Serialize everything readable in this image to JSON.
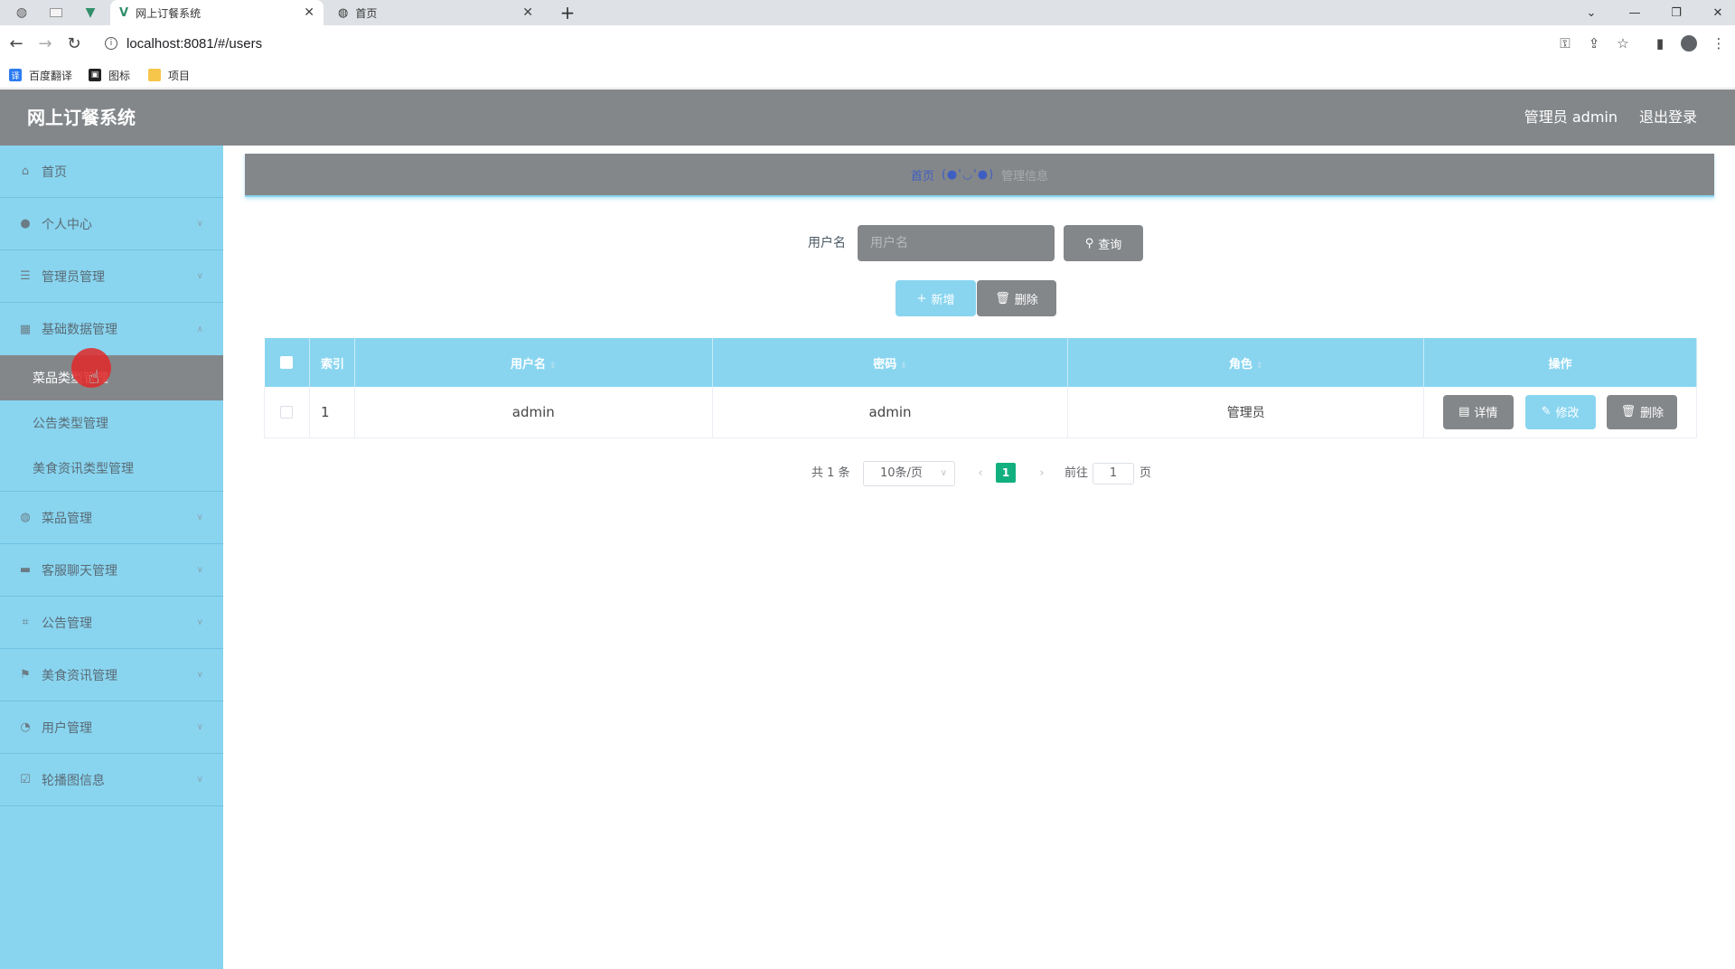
{
  "browser": {
    "tabs": [
      {
        "title": "网上订餐系统",
        "favicon": "vue-logo-icon",
        "active": true
      },
      {
        "title": "首页",
        "favicon": "globe-icon",
        "active": false
      }
    ],
    "url": "localhost:8081/#/users",
    "bookmarks": [
      {
        "label": "百度翻译",
        "icon": "baidu-translate-icon",
        "color": "#2d7cf2"
      },
      {
        "label": "图标",
        "icon": "iconfont-icon",
        "color": "#222222"
      },
      {
        "label": "项目",
        "icon": "folder-icon",
        "color": "#f6c64b"
      }
    ]
  },
  "header": {
    "title": "网上订餐系统",
    "user": "管理员 admin",
    "logout": "退出登录"
  },
  "sidebar": {
    "items": [
      {
        "label": "首页",
        "icon": "home-icon"
      },
      {
        "label": "个人中心",
        "icon": "user-icon"
      },
      {
        "label": "管理员管理",
        "icon": "list-icon"
      },
      {
        "label": "基础数据管理",
        "icon": "grid-icon",
        "expanded": true,
        "children": [
          {
            "label": "菜品类型管理",
            "active": true
          },
          {
            "label": "公告类型管理"
          },
          {
            "label": "美食资讯类型管理"
          }
        ]
      },
      {
        "label": "菜品管理",
        "icon": "globe-icon"
      },
      {
        "label": "客服聊天管理",
        "icon": "monitor-icon"
      },
      {
        "label": "公告管理",
        "icon": "crop-icon"
      },
      {
        "label": "美食资讯管理",
        "icon": "flag-icon"
      },
      {
        "label": "用户管理",
        "icon": "dashboard-icon"
      },
      {
        "label": "轮播图信息",
        "icon": "clipboard-check-icon"
      }
    ]
  },
  "breadcrumb": {
    "home": "首页",
    "face": "(●'◡'●)",
    "current": "管理信息"
  },
  "search": {
    "label": "用户名",
    "placeholder": "用户名",
    "button": "查询"
  },
  "actions": {
    "add": "新增",
    "delete": "删除"
  },
  "table": {
    "columns": [
      "索引",
      "用户名",
      "密码",
      "角色",
      "操作"
    ],
    "rows": [
      {
        "index": "1",
        "username": "admin",
        "password": "admin",
        "role": "管理员"
      }
    ],
    "row_actions": {
      "detail": "详情",
      "edit": "修改",
      "delete": "删除"
    }
  },
  "pagination": {
    "total": "共 1 条",
    "page_size": "10条/页",
    "current_page": "1",
    "goto_label": "前往",
    "goto_value": "1",
    "page_suffix": "页"
  },
  "colors": {
    "sidebar_bg": "#89d5f0",
    "header_bg": "#84878a",
    "active_page": "#13b07f"
  }
}
